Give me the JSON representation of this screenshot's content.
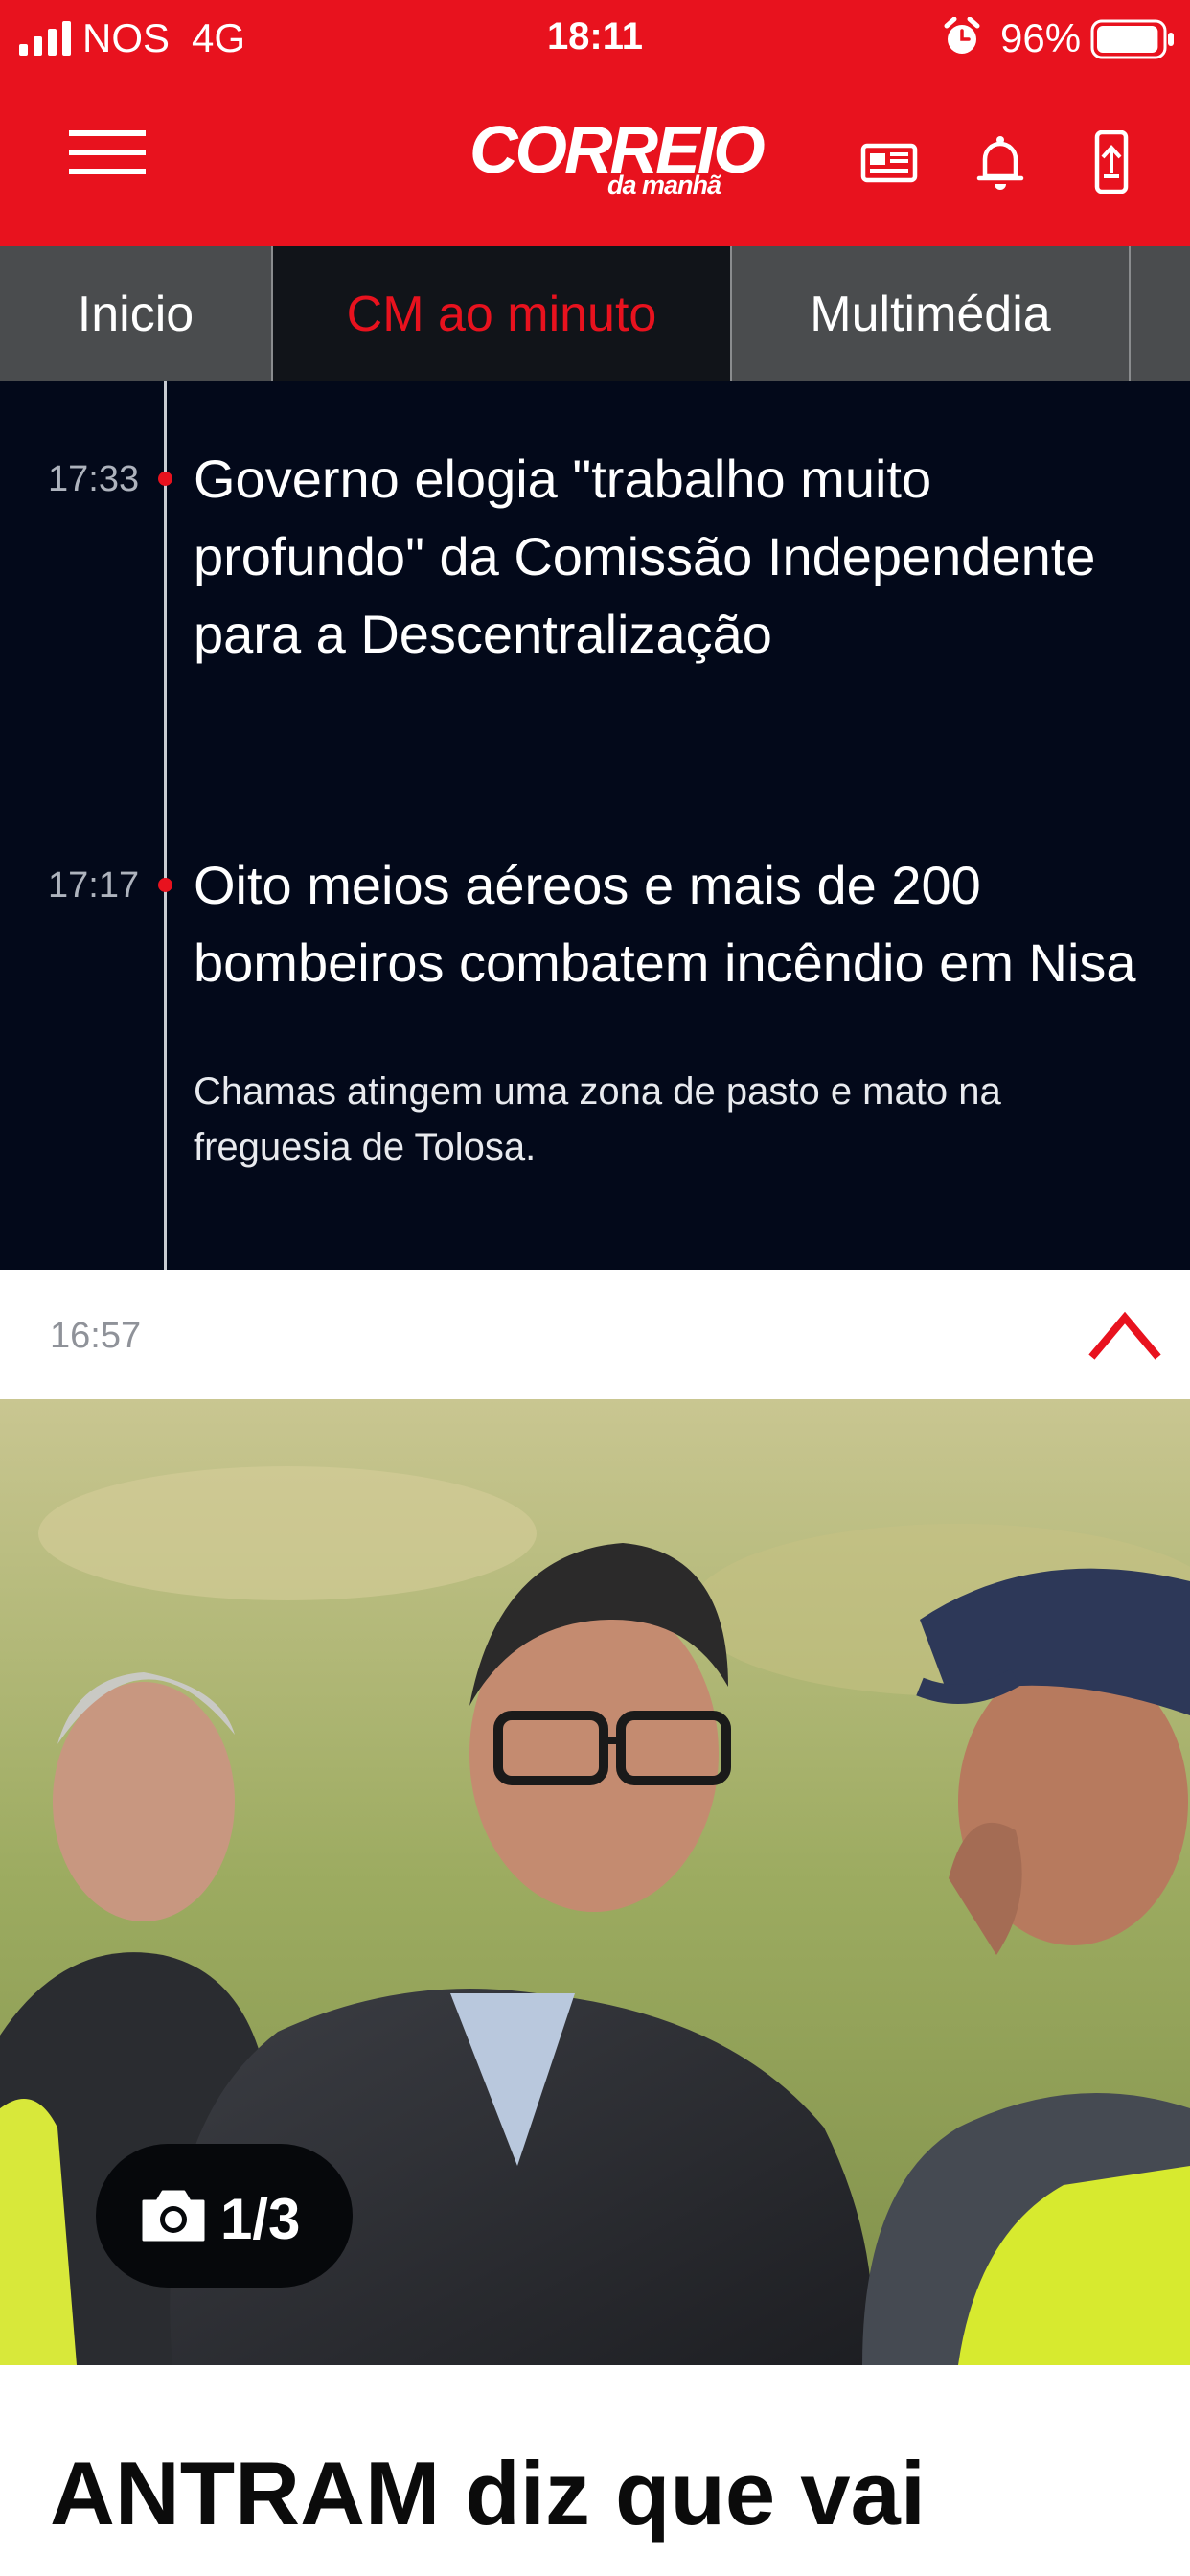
{
  "status_bar": {
    "carrier": "NOS",
    "network": "4G",
    "time": "18:11",
    "battery": "96%",
    "battery_level": 0.96
  },
  "header": {
    "logo_main": "CORREIO",
    "logo_sub": "da manhã",
    "brand_color": "#e8121e"
  },
  "tabs": [
    {
      "label": "Inicio",
      "active": false
    },
    {
      "label": "CM ao minuto",
      "active": true
    },
    {
      "label": "Multimédia",
      "active": false
    }
  ],
  "feed": [
    {
      "time": "17:33",
      "title": "Governo elogia \"trabalho muito profundo\" da Comissão Independente para a Descentralização",
      "summary": ""
    },
    {
      "time": "17:17",
      "title": "Oito meios aéreos e mais de 200 bombeiros combatem incêndio em Nisa",
      "summary": "Chamas atingem uma zona de pasto e mato na freguesia de Tolosa."
    }
  ],
  "expanded_item": {
    "time": "16:57",
    "gallery_count": "1/3",
    "title": "ANTRAM diz que vai"
  },
  "icons": {
    "menu": "hamburger-menu-icon",
    "newspaper": "newspaper-icon",
    "bell": "bell-icon",
    "phone": "phone-share-icon",
    "collapse": "chevron-up-icon",
    "camera": "camera-icon"
  }
}
